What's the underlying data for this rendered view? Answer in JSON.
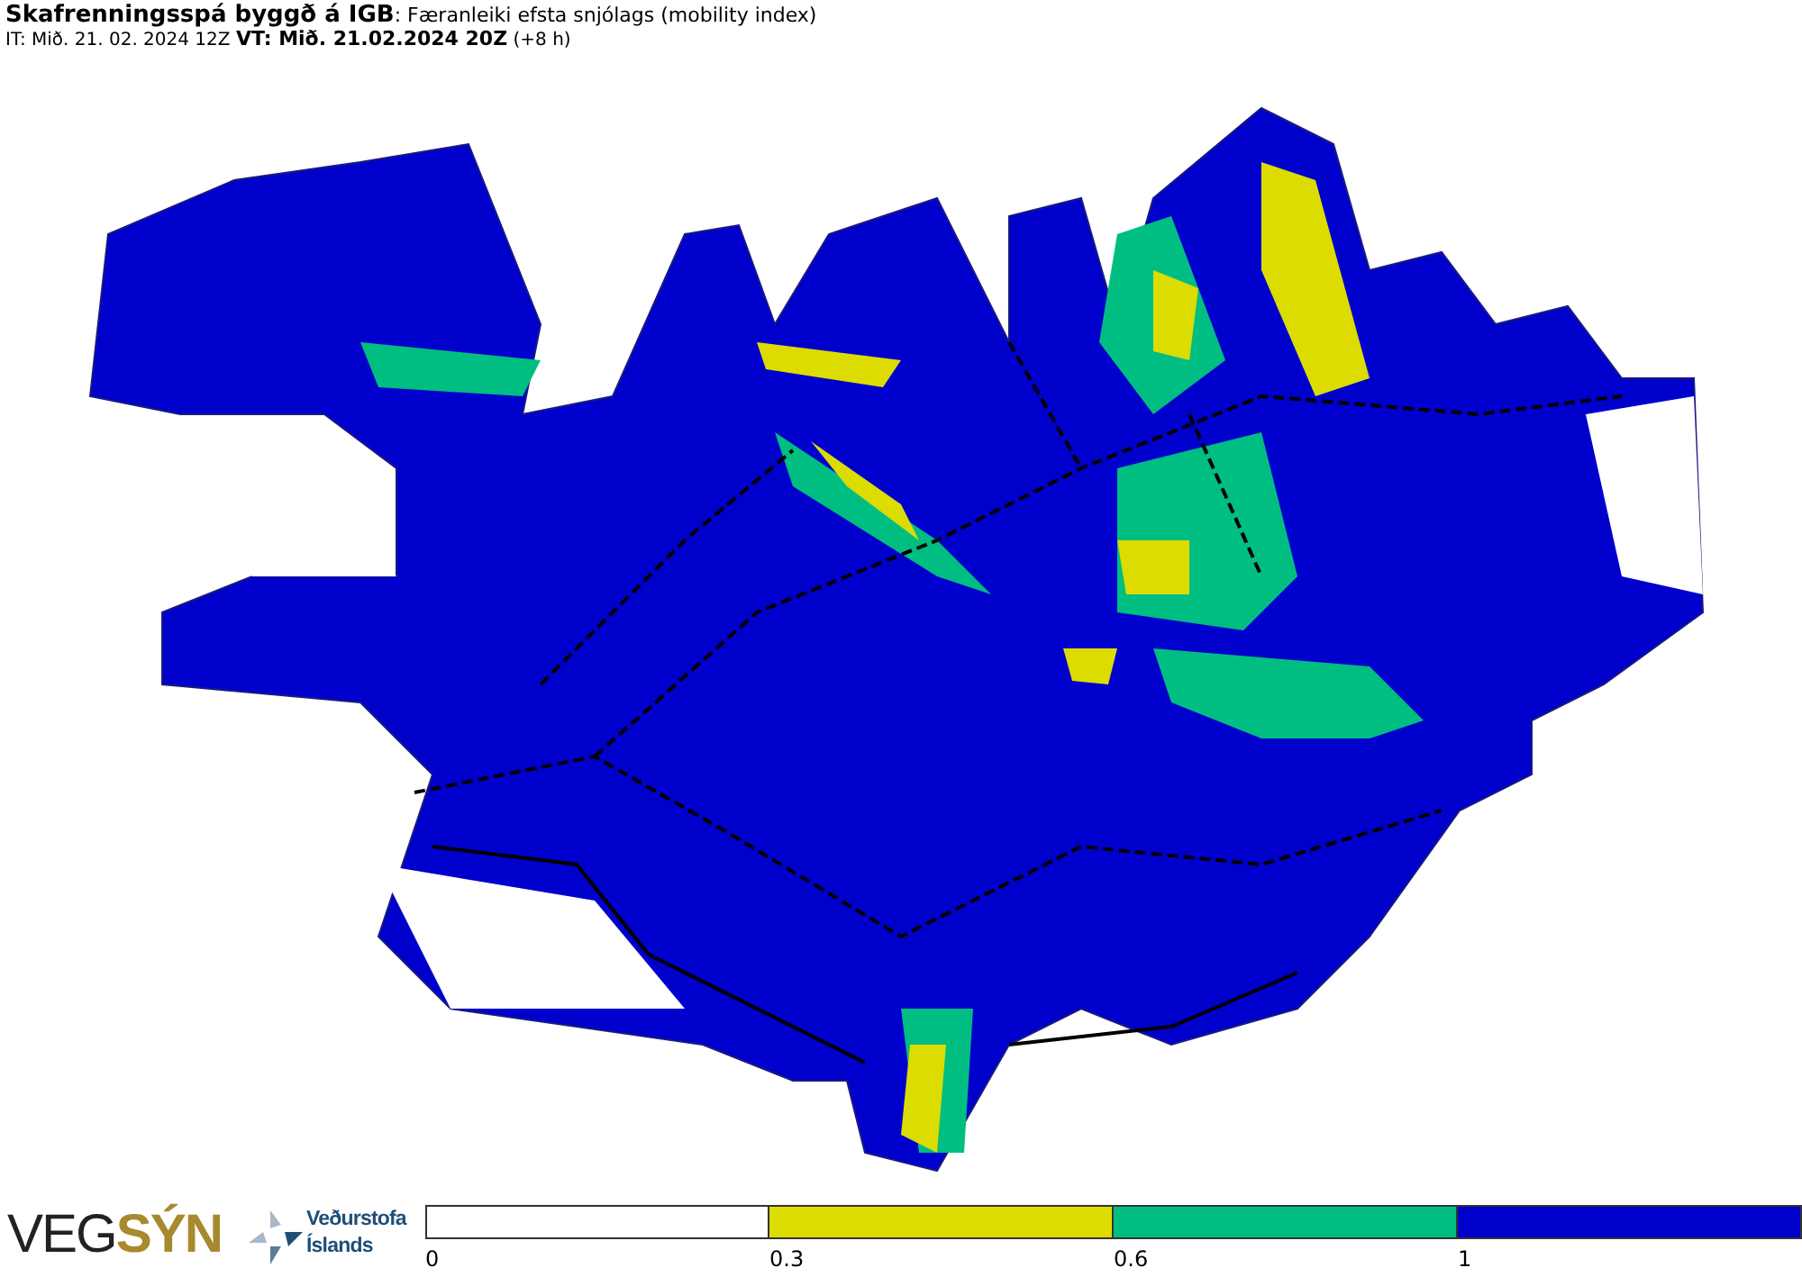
{
  "header": {
    "title": "**Skafrenningsspá byggð á IGB**: Færanleiki efsta snjólags (mobility index)",
    "subtitle": "IT: Mið. 21. 02. 2024 12Z **VT: Mið. 21.02.2024 20Z** (+8 h)"
  },
  "logos": {
    "vegsyn_dark": "VEG",
    "vegsyn_gold": "SÝN",
    "vedurstofa_line1": "Veðurstofa",
    "vedurstofa_line2": "Íslands"
  },
  "legend": [
    {
      "label": "0",
      "color": "#ffffff"
    },
    {
      "label": "0.3",
      "color": "#dcdc00"
    },
    {
      "label": "0.6",
      "color": "#00be82"
    },
    {
      "label": "1",
      "color": "#0000cd"
    }
  ]
}
